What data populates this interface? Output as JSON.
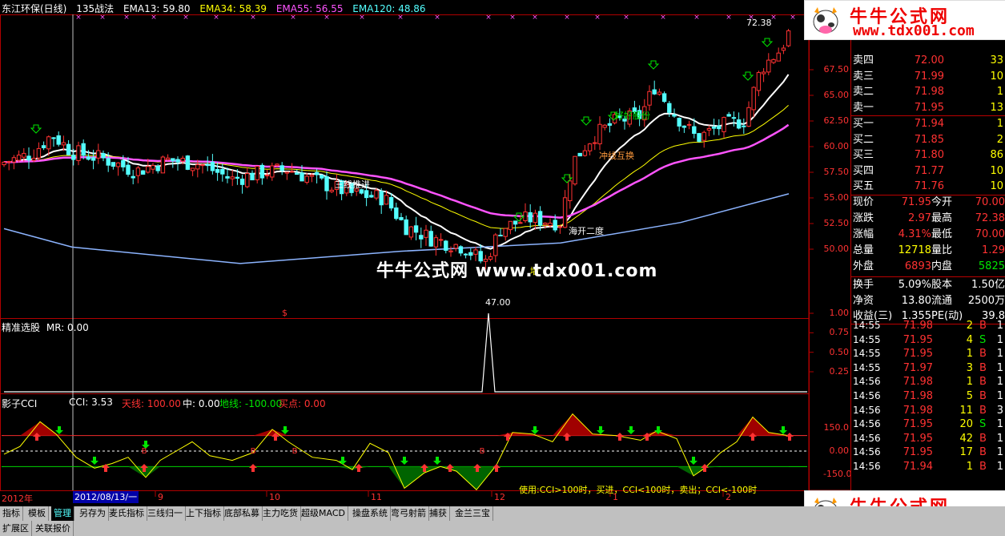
{
  "header": {
    "stock_name": "东江环保(日线)",
    "strategy": "135战法",
    "ema13": "EMA13: 59.80",
    "ema34": "EMA34: 58.39",
    "ema55": "EMA55: 56.55",
    "ema120": "EMA120: 48.86"
  },
  "price_axis": [
    "67.50",
    "65.00",
    "62.50",
    "60.00",
    "57.50",
    "55.00",
    "52.50",
    "50.00"
  ],
  "annotations": {
    "high": "72.38",
    "low": "47.00",
    "label_1": "三线推进",
    "label_2": "海开二度",
    "label_3": "冲线互换",
    "label_4": "好好股份",
    "marker_s": "$",
    "marker_m": "墙"
  },
  "panel2": {
    "title": "精准选股",
    "mr": "MR: 0.00",
    "axis": [
      "1.00",
      "0.75",
      "0.50",
      "0.25"
    ]
  },
  "panel3": {
    "title": "影子CCI",
    "cci": "CCI: 3.53",
    "tianxian": "天线: 100.00",
    "zhong": "中: 0.00",
    "dixian": "地线: -100.00",
    "maidian": "买点: 0.00",
    "axis": [
      "150.0",
      "0.00",
      "-150.0"
    ],
    "note": "使用:CCI>100时，买进，CCI<100时，卖出；CCI<-100时"
  },
  "date_axis": {
    "year": "2012年",
    "cursor_date": "2012/08/13/一",
    "months": [
      "9",
      "10",
      "11",
      "12",
      "1",
      "2"
    ]
  },
  "watermark": {
    "center": "牛牛公式网 www.tdx001.com",
    "logo_title": "牛牛公式网",
    "logo_url": "www.tdx001.com"
  },
  "orderbook": {
    "sell": [
      {
        "label": "卖四",
        "price": "72.00",
        "vol": "33"
      },
      {
        "label": "卖三",
        "price": "71.99",
        "vol": "10"
      },
      {
        "label": "卖二",
        "price": "71.98",
        "vol": "1"
      },
      {
        "label": "卖一",
        "price": "71.95",
        "vol": "13"
      }
    ],
    "buy": [
      {
        "label": "买一",
        "price": "71.94",
        "vol": "1"
      },
      {
        "label": "买二",
        "price": "71.85",
        "vol": "2"
      },
      {
        "label": "买三",
        "price": "71.80",
        "vol": "86"
      },
      {
        "label": "买四",
        "price": "71.77",
        "vol": "10"
      },
      {
        "label": "买五",
        "price": "71.76",
        "vol": "10"
      }
    ]
  },
  "quote": [
    {
      "a": "现价",
      "b": "71.95",
      "c": "今开",
      "d": "70.00"
    },
    {
      "a": "涨跌",
      "b": "2.97",
      "c": "最高",
      "d": "72.38"
    },
    {
      "a": "涨幅",
      "b": "4.31%",
      "c": "最低",
      "d": "70.00"
    },
    {
      "a": "总量",
      "b": "12718",
      "c": "量比",
      "d": "1.29"
    },
    {
      "a": "外盘",
      "b": "6893",
      "c": "内盘",
      "d": "5825"
    }
  ],
  "fundamentals": [
    {
      "a": "换手",
      "b": "5.09%",
      "c": "股本",
      "d": "1.50亿"
    },
    {
      "a": "净资",
      "b": "13.80",
      "c": "流通",
      "d": "2500万"
    },
    {
      "a": "收益(三)",
      "b": "1.355",
      "c": "PE(动)",
      "d": "39.8"
    }
  ],
  "ticks": [
    {
      "t": "14:55",
      "p": "71.98",
      "v": "2",
      "s": "B",
      "n": "1"
    },
    {
      "t": "14:55",
      "p": "71.95",
      "v": "4",
      "s": "S",
      "n": "1"
    },
    {
      "t": "14:55",
      "p": "71.95",
      "v": "1",
      "s": "B",
      "n": "1"
    },
    {
      "t": "14:55",
      "p": "71.97",
      "v": "3",
      "s": "B",
      "n": "1"
    },
    {
      "t": "14:56",
      "p": "71.98",
      "v": "1",
      "s": "B",
      "n": "1"
    },
    {
      "t": "14:56",
      "p": "71.98",
      "v": "5",
      "s": "B",
      "n": "1"
    },
    {
      "t": "14:56",
      "p": "71.98",
      "v": "11",
      "s": "B",
      "n": "3"
    },
    {
      "t": "14:56",
      "p": "71.95",
      "v": "20",
      "s": "S",
      "n": "1"
    },
    {
      "t": "14:56",
      "p": "71.95",
      "v": "42",
      "s": "B",
      "n": "1"
    },
    {
      "t": "14:56",
      "p": "71.95",
      "v": "17",
      "s": "B",
      "n": "1"
    },
    {
      "t": "14:56",
      "p": "71.94",
      "v": "1",
      "s": "B",
      "n": "1"
    }
  ],
  "tabs": [
    "指标",
    "模板",
    "管理",
    "另存为",
    "麦氏指标",
    "三线归一",
    "上下指标",
    "底部私募",
    "主力吃货",
    "超级MACD",
    "操盘系统",
    "弯弓射箭",
    "捕获",
    "金兰三宝"
  ],
  "tabs_row2": [
    "扩展区",
    "关联报价"
  ],
  "colors": {
    "up": "#ff3232",
    "down": "#54ffff",
    "ema13": "#ffffff",
    "ema34": "#ffff00",
    "ema55": "#ff54ff",
    "ema120": "#8cb4ff",
    "accent": "#ff0000"
  }
}
